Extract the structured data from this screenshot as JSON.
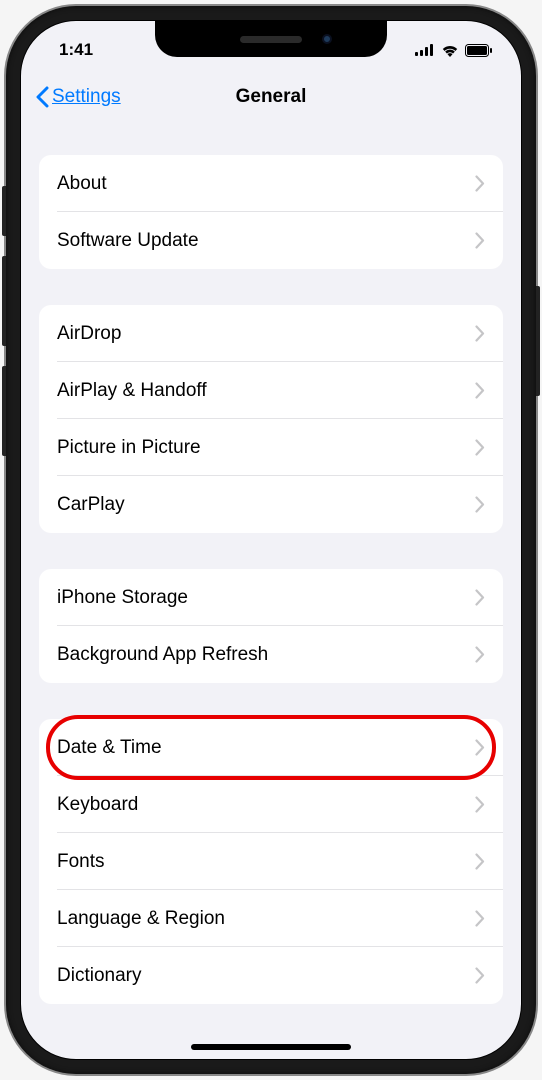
{
  "status": {
    "time": "1:41"
  },
  "nav": {
    "back_label": "Settings",
    "title": "General"
  },
  "groups": [
    {
      "items": [
        {
          "label": "About",
          "key": "about"
        },
        {
          "label": "Software Update",
          "key": "software-update"
        }
      ]
    },
    {
      "items": [
        {
          "label": "AirDrop",
          "key": "airdrop"
        },
        {
          "label": "AirPlay & Handoff",
          "key": "airplay-handoff"
        },
        {
          "label": "Picture in Picture",
          "key": "pip"
        },
        {
          "label": "CarPlay",
          "key": "carplay"
        }
      ]
    },
    {
      "items": [
        {
          "label": "iPhone Storage",
          "key": "iphone-storage"
        },
        {
          "label": "Background App Refresh",
          "key": "background-app-refresh"
        }
      ]
    },
    {
      "items": [
        {
          "label": "Date & Time",
          "key": "date-time",
          "highlighted": true
        },
        {
          "label": "Keyboard",
          "key": "keyboard"
        },
        {
          "label": "Fonts",
          "key": "fonts"
        },
        {
          "label": "Language & Region",
          "key": "language-region"
        },
        {
          "label": "Dictionary",
          "key": "dictionary"
        }
      ]
    }
  ]
}
